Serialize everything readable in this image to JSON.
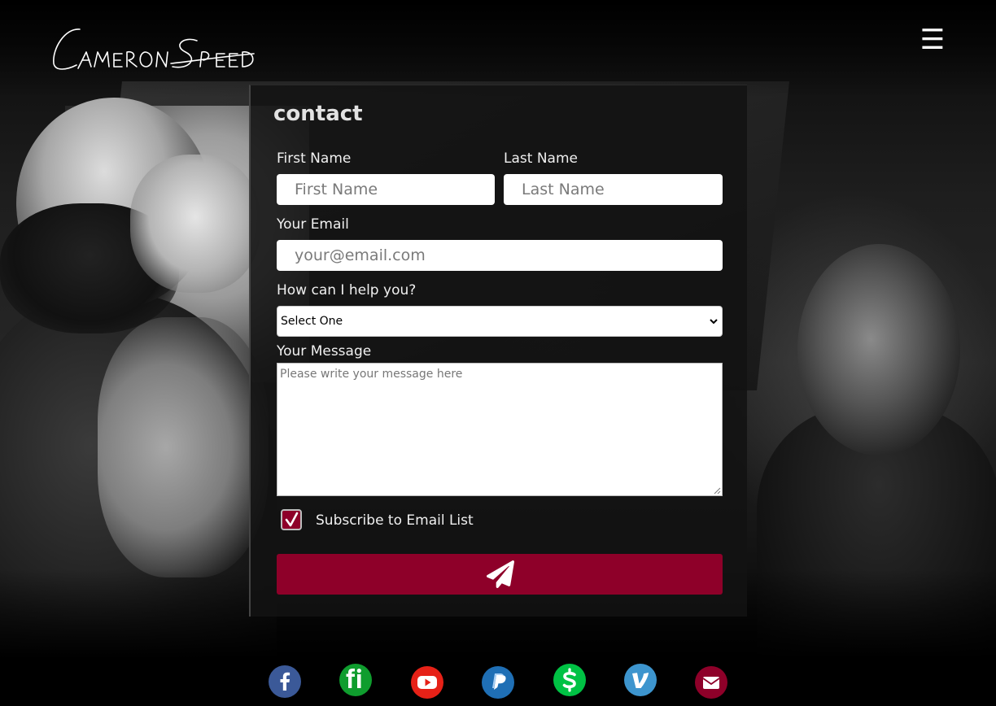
{
  "header": {
    "logo_text": "Cameron Speed",
    "menu_glyph": "☰"
  },
  "contact": {
    "title": "contact",
    "first_name": {
      "label": "First Name",
      "placeholder": "First Name",
      "value": ""
    },
    "last_name": {
      "label": "Last Name",
      "placeholder": "Last Name",
      "value": ""
    },
    "email": {
      "label": "Your Email",
      "placeholder": "your@email.com",
      "value": ""
    },
    "help": {
      "label": "How can I help you?",
      "selected": "Select One"
    },
    "message": {
      "label": "Your Message",
      "placeholder": "Please write your message here",
      "value": ""
    },
    "subscribe": {
      "label": "Subscribe to Email List",
      "checked": true
    },
    "submit_icon": "paper-plane-icon"
  },
  "social": [
    {
      "name": "facebook",
      "icon": "facebook-icon",
      "color": "#3b5998"
    },
    {
      "name": "fi",
      "icon": "fi-icon",
      "color": "#0f9d2e"
    },
    {
      "name": "youtube",
      "icon": "youtube-icon",
      "color": "#e62117"
    },
    {
      "name": "paypal",
      "icon": "paypal-icon",
      "color": "#1f6fb5"
    },
    {
      "name": "cashapp",
      "icon": "cashapp-icon",
      "color": "#00c244"
    },
    {
      "name": "venmo",
      "icon": "venmo-icon",
      "color": "#3d95ce"
    },
    {
      "name": "email",
      "icon": "envelope-icon",
      "color": "#8e0029"
    }
  ],
  "colors": {
    "accent": "#8e0029",
    "panel_bg": "#121212",
    "text": "#f0f0f0"
  }
}
